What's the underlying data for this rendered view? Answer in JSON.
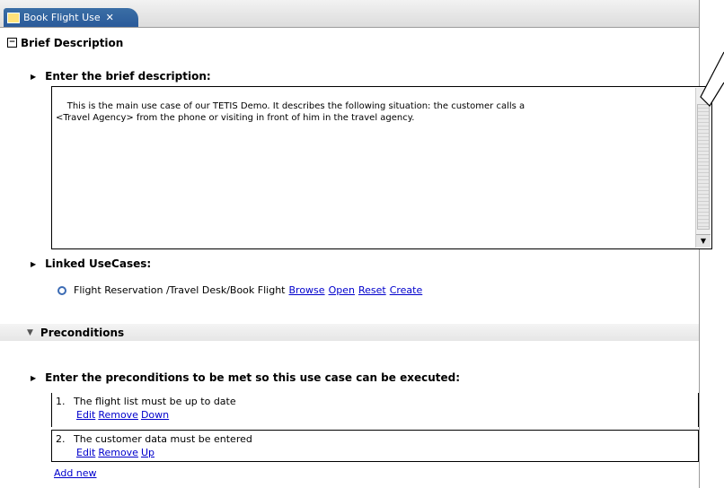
{
  "tab": {
    "title": "Book Flight Use",
    "close": "✕"
  },
  "brief": {
    "section_title": "Brief Description",
    "toggle": "−",
    "field_label": "Enter the brief description:",
    "text": "This is the main use case of our TETIS Demo. It describes the following situation: the customer calls a\n<Travel Agency> from the phone or visiting in front of him in the travel agency."
  },
  "linked": {
    "label": "Linked UseCases:",
    "path": "Flight Reservation /Travel Desk/Book Flight",
    "links": [
      "Browse",
      "Open",
      "Reset",
      "Create"
    ]
  },
  "preconditions": {
    "section_title": "Preconditions",
    "field_label": "Enter the preconditions to be met so this use case can be executed:",
    "items": [
      {
        "num": "1.",
        "text": "The flight list must be up to date",
        "actions": [
          "Edit",
          "Remove",
          "Down"
        ]
      },
      {
        "num": "2.",
        "text": "The customer data must be entered",
        "actions": [
          "Edit",
          "Remove",
          "Up"
        ]
      }
    ],
    "add_new": "Add new"
  }
}
